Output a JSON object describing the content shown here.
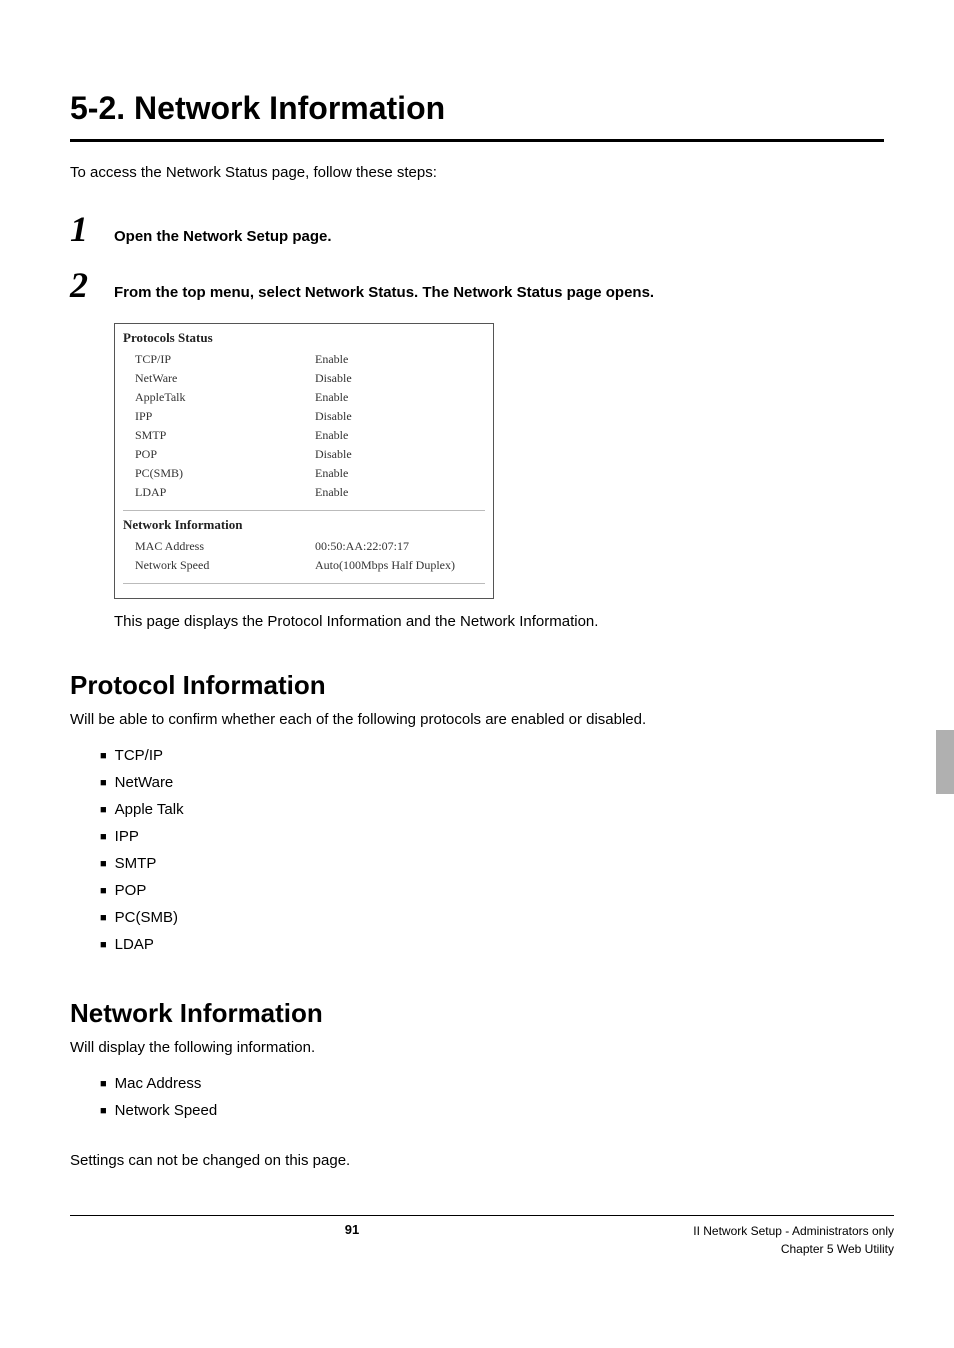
{
  "title": "5-2. Network Information",
  "intro": "To access the Network Status page, follow these steps:",
  "steps": [
    {
      "num": "1",
      "text": "Open the Network Setup page."
    },
    {
      "num": "2",
      "text": "From the top menu, select Network Status. The Network Status page opens."
    }
  ],
  "figure": {
    "protocols_title": "Protocols Status",
    "protocols": [
      {
        "name": "TCP/IP",
        "status": "Enable"
      },
      {
        "name": "NetWare",
        "status": "Disable"
      },
      {
        "name": "AppleTalk",
        "status": "Enable"
      },
      {
        "name": "IPP",
        "status": "Disable"
      },
      {
        "name": "SMTP",
        "status": "Enable"
      },
      {
        "name": "POP",
        "status": "Disable"
      },
      {
        "name": "PC(SMB)",
        "status": "Enable"
      },
      {
        "name": "LDAP",
        "status": "Enable"
      }
    ],
    "network_title": "Network Information",
    "network": [
      {
        "name": "MAC Address",
        "value": "00:50:AA:22:07:17"
      },
      {
        "name": "Network Speed",
        "value": "Auto(100Mbps Half Duplex)"
      }
    ]
  },
  "caption": "This page displays the Protocol Information and the Network Information.",
  "section1": {
    "title": "Protocol Information",
    "text": "Will be able to confirm whether each of the following protocols are enabled or disabled.",
    "items": [
      "TCP/IP",
      "NetWare",
      "Apple Talk",
      "IPP",
      "SMTP",
      "POP",
      "PC(SMB)",
      "LDAP"
    ]
  },
  "section2": {
    "title": "Network Information",
    "text": "Will display the following information.",
    "items": [
      "Mac Address",
      "Network Speed"
    ]
  },
  "closing": "Settings can not be changed on this page.",
  "footer": {
    "page": "91",
    "right1": "II Network Setup - Administrators only",
    "right2": "Chapter 5 Web Utility"
  }
}
